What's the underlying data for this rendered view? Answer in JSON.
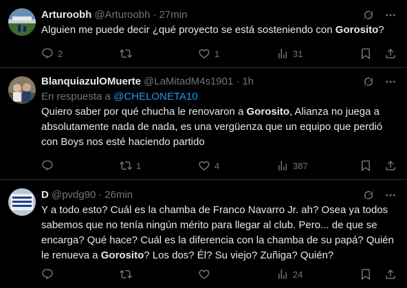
{
  "tweets": [
    {
      "name": "Arturoobh",
      "handle": "@Arturoobh",
      "separator": "·",
      "time": "27min",
      "reply_prefix": "",
      "reply_mention": "",
      "text_before": "Alguien me puede decir ¿qué proyecto se está sosteniendo con ",
      "text_bold": "Gorosito",
      "text_after": "?",
      "replies": "2",
      "retweets": "",
      "likes": "1",
      "views": "31"
    },
    {
      "name": "BlanquiazulOMuerte",
      "handle": "@LaMitadM4s1901",
      "separator": "·",
      "time": "1h",
      "reply_prefix": "En respuesta a ",
      "reply_mention": "@CHELONETA10",
      "text_before": "Quiero saber por qué chucha le renovaron a ",
      "text_bold": "Gorosito",
      "text_after": ", Alianza no juega a absolutamente nada de nada, es una vergüenza que un equipo que perdió con Boys nos esté haciendo partido",
      "replies": "",
      "retweets": "1",
      "likes": "4",
      "views": "387"
    },
    {
      "name": "D",
      "handle": "@pvdg90",
      "separator": "·",
      "time": "26min",
      "reply_prefix": "",
      "reply_mention": "",
      "text_before": "Y a todo esto? Cuál es la chamba de Franco Navarro Jr. ah? Osea ya todos sabemos que no tenía ningún mérito para llegar al club. Pero... de que se encarga? Qué hace? Cuál es la diferencia con la chamba de su papá? Quién le renueva a ",
      "text_bold": "Gorosito",
      "text_after": "? Los dos? Él? Su viejo? Zuñiga? Quién?",
      "replies": "",
      "retweets": "",
      "likes": "",
      "views": "24"
    }
  ],
  "icons": {
    "grok": "grok-icon",
    "more": "more-icon",
    "reply": "reply-icon",
    "retweet": "retweet-icon",
    "like": "heart-icon",
    "views": "views-icon",
    "bookmark": "bookmark-icon",
    "share": "share-icon"
  },
  "colors": {
    "background": "#000000",
    "text": "#e7e9ea",
    "muted": "#71767b",
    "link": "#1d9bf0",
    "divider": "#2f3336"
  }
}
